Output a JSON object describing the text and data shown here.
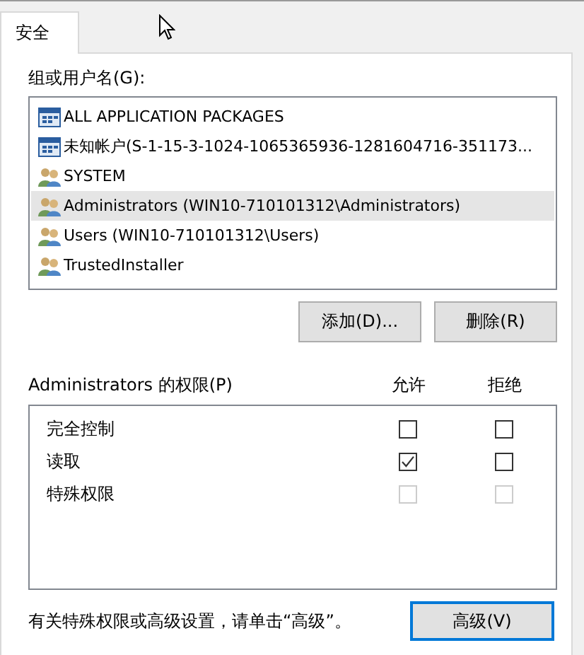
{
  "tabs": [
    {
      "label": "安全",
      "selected": true
    }
  ],
  "principals_label": "组或用户名(G):",
  "principals": [
    {
      "name": "ALL APPLICATION PACKAGES",
      "kind": "package",
      "selected": false
    },
    {
      "name": "未知帐户(S-1-15-3-1024-1065365936-1281604716-351173...",
      "kind": "package",
      "selected": false
    },
    {
      "name": "SYSTEM",
      "kind": "group",
      "selected": false
    },
    {
      "name": "Administrators (WIN10-710101312\\Administrators)",
      "kind": "group",
      "selected": true
    },
    {
      "name": "Users (WIN10-710101312\\Users)",
      "kind": "group",
      "selected": false
    },
    {
      "name": "TrustedInstaller",
      "kind": "group",
      "selected": false
    }
  ],
  "buttons": [
    "添加(D)...",
    "删除(R)"
  ],
  "permissions_label": "Administrators 的权限(P)",
  "columns": [
    "允许",
    "拒绝"
  ],
  "permissions": [
    {
      "name": "完全控制",
      "allow": {
        "checked": false,
        "disabled": false
      },
      "deny": {
        "checked": false,
        "disabled": false
      }
    },
    {
      "name": "读取",
      "allow": {
        "checked": true,
        "disabled": false
      },
      "deny": {
        "checked": false,
        "disabled": false
      }
    },
    {
      "name": "特殊权限",
      "allow": {
        "checked": false,
        "disabled": true
      },
      "deny": {
        "checked": false,
        "disabled": true
      }
    }
  ],
  "footer_text": "有关特殊权限或高级设置，请单击“高级”。",
  "advanced_button": {
    "label": "高级(V)",
    "focused": true
  }
}
